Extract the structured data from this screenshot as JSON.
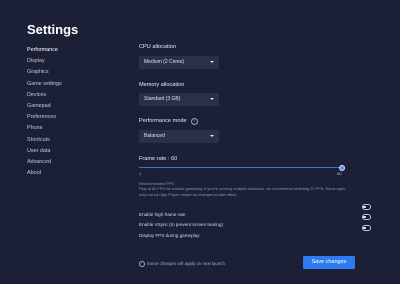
{
  "page": {
    "title": "Settings"
  },
  "sidebar": {
    "items": [
      {
        "label": "Performance"
      },
      {
        "label": "Display"
      },
      {
        "label": "Graphics"
      },
      {
        "label": "Game settings"
      },
      {
        "label": "Devices"
      },
      {
        "label": "Gamepad"
      },
      {
        "label": "Preferences"
      },
      {
        "label": "Phone"
      },
      {
        "label": "Shortcuts"
      },
      {
        "label": "User data"
      },
      {
        "label": "Advanced"
      },
      {
        "label": "About"
      }
    ]
  },
  "cpu": {
    "label": "CPU allocation",
    "value": "Medium (2 Cores)"
  },
  "memory": {
    "label": "Memory allocation",
    "value": "Standard (3 GB)"
  },
  "performance_mode": {
    "label": "Performance mode",
    "value": "Balanced",
    "help_glyph": "?"
  },
  "frame_rate": {
    "label": "Frame rate : 60",
    "min_label": "1",
    "max_label": "60",
    "value": 60,
    "min": 1,
    "max": 60,
    "recommended_title": "Recommended FPS",
    "recommended_text": "Play at 60 FPS for smooth gameplay. If you're running multiple instances, we recommend selecting 20 FPS. Some apps may not run App Player restart for changes to take effect."
  },
  "toggles": [
    {
      "label": "Enable high frame rate",
      "on": false
    },
    {
      "label": "Enable VSync (to prevent screen tearing)",
      "on": false
    },
    {
      "label": "Display FPS during gameplay",
      "on": false
    }
  ],
  "footer": {
    "note": "Some changes will apply on next launch",
    "info_glyph": "i",
    "save_label": "Save changes"
  },
  "colors": {
    "background": "#1c2036",
    "panel": "#2a2f4a",
    "accent": "#2d7bf0",
    "slider": "#3d6fe0"
  },
  "icons": {
    "dropdown": "chevron-down-icon",
    "help": "question-circle-icon",
    "info": "info-circle-icon"
  }
}
